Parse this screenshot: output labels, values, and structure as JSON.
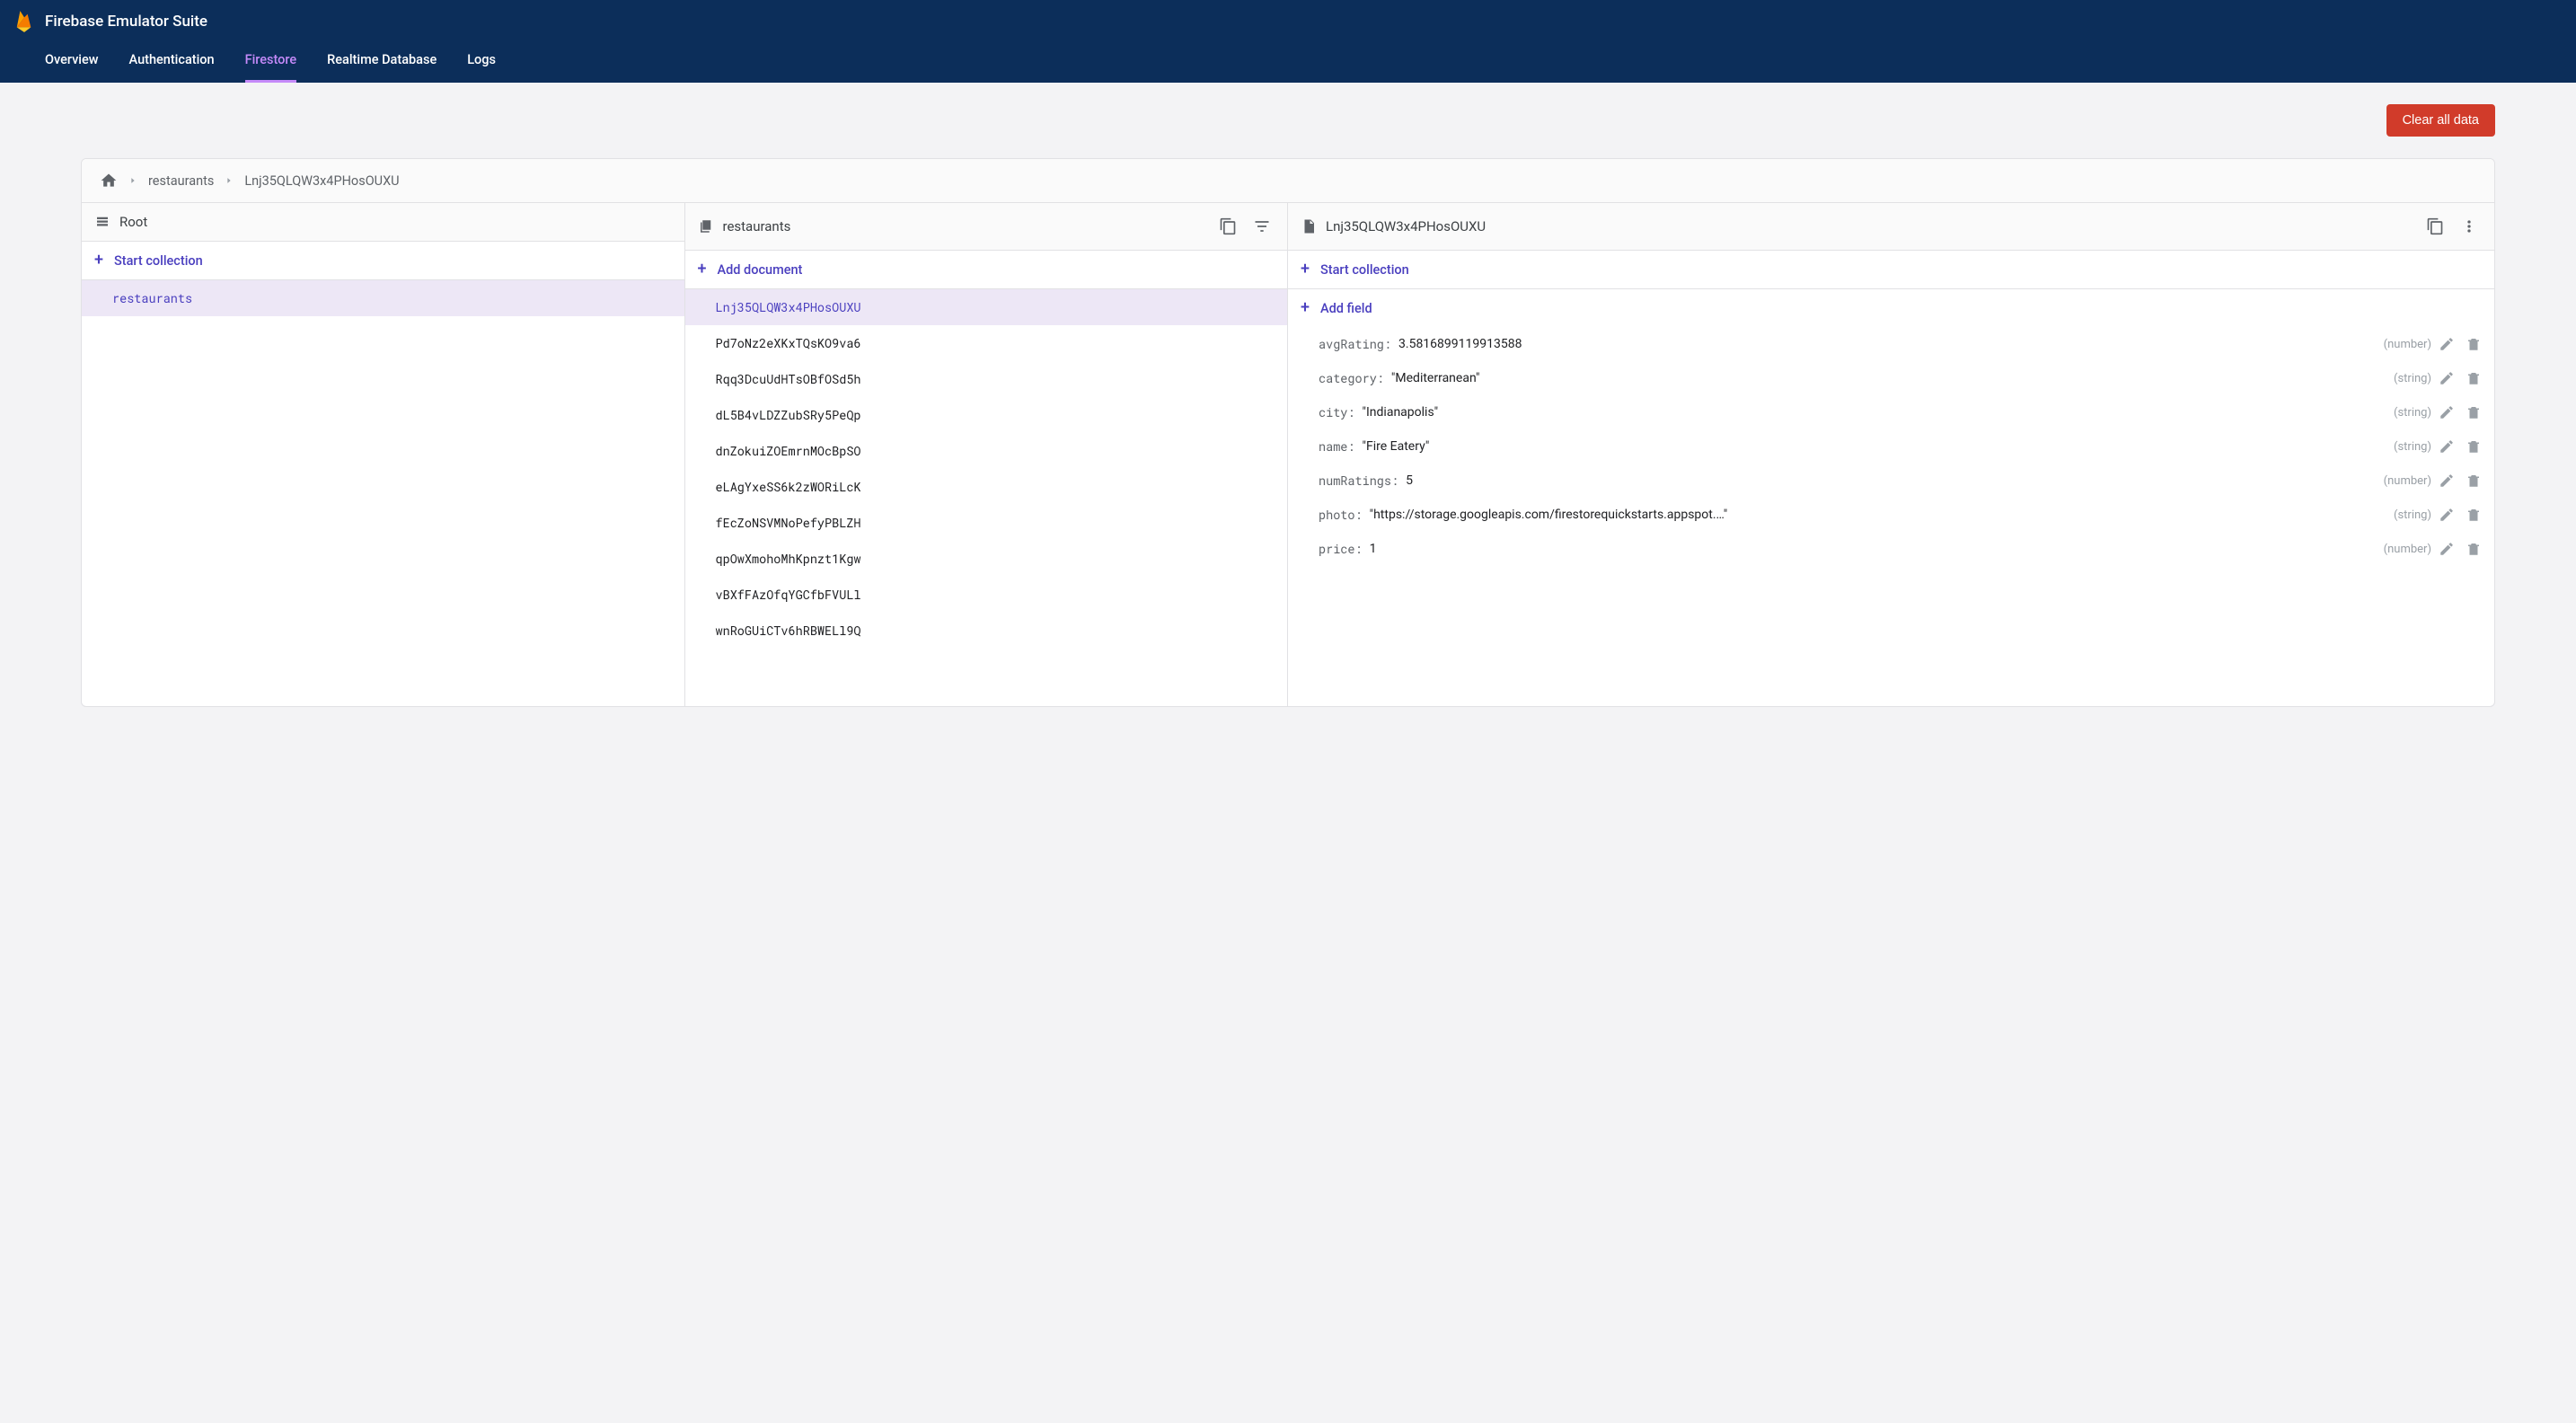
{
  "header": {
    "title": "Firebase Emulator Suite",
    "tabs": [
      "Overview",
      "Authentication",
      "Firestore",
      "Realtime Database",
      "Logs"
    ],
    "active_tab": "Firestore"
  },
  "toolbar": {
    "clear_label": "Clear all data"
  },
  "breadcrumb": {
    "items": [
      "restaurants",
      "Lnj35QLQW3x4PHosOUXU"
    ]
  },
  "col_root": {
    "title": "Root",
    "action": "Start collection",
    "items": [
      "restaurants"
    ],
    "selected": "restaurants"
  },
  "col_docs": {
    "title": "restaurants",
    "action": "Add document",
    "items": [
      "Lnj35QLQW3x4PHosOUXU",
      "Pd7oNz2eXKxTQsKO9va6",
      "Rqq3DcuUdHTsOBfOSd5h",
      "dL5B4vLDZZubSRy5PeQp",
      "dnZokuiZOEmrnMOcBpSO",
      "eLAgYxeSS6k2zWORiLcK",
      "fEcZoNSVMNoPefyPBLZH",
      "qpOwXmohoMhKpnzt1Kgw",
      "vBXfFAzOfqYGCfbFVULl",
      "wnRoGUiCTv6hRBWELl9Q"
    ],
    "selected": "Lnj35QLQW3x4PHosOUXU"
  },
  "col_fields": {
    "title": "Lnj35QLQW3x4PHosOUXU",
    "action_collection": "Start collection",
    "action_field": "Add field",
    "fields": [
      {
        "key": "avgRating",
        "value": "3.5816899119913588",
        "type": "number",
        "quoted": false
      },
      {
        "key": "category",
        "value": "Mediterranean",
        "type": "string",
        "quoted": true
      },
      {
        "key": "city",
        "value": "Indianapolis",
        "type": "string",
        "quoted": true
      },
      {
        "key": "name",
        "value": "Fire Eatery",
        "type": "string",
        "quoted": true
      },
      {
        "key": "numRatings",
        "value": "5",
        "type": "number",
        "quoted": false
      },
      {
        "key": "photo",
        "value": "https://storage.googleapis.com/firestorequickstarts.appspot.…",
        "type": "string",
        "quoted": true
      },
      {
        "key": "price",
        "value": "1",
        "type": "number",
        "quoted": false
      }
    ]
  }
}
